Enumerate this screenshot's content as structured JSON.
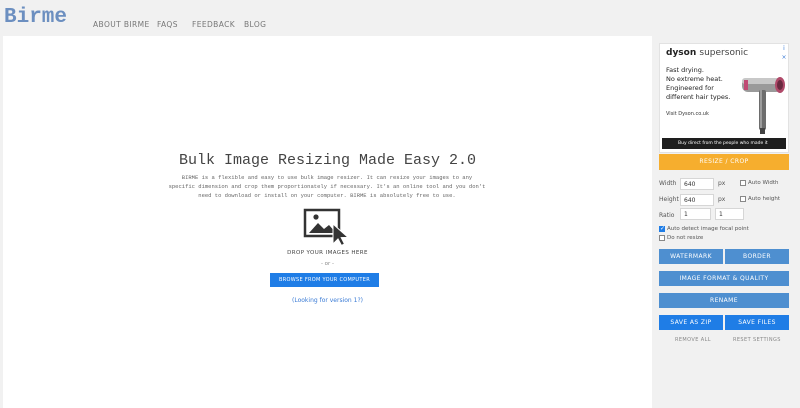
{
  "header": {
    "logo": "Birme",
    "nav": [
      "ABOUT BIRME",
      "FAQS",
      "FEEDBACK",
      "BLOG"
    ]
  },
  "main": {
    "headline": "Bulk Image Resizing Made Easy 2.0",
    "description": "BIRME is a flexible and easy to use bulk image resizer. It can resize your images to any specific dimension and crop them proportionately if necessary. It's an online tool and you don't need to download or install on your computer. BIRME is absolutely free to use.",
    "drop_text": "DROP YOUR IMAGES HERE",
    "or_text": "- or -",
    "browse_label": "BROWSE FROM YOUR COMPUTER",
    "v1_link": "(Looking for version 1?)"
  },
  "ad": {
    "brand": "dyson",
    "brand_sub": "supersonic",
    "copy": "Fast drying.\nNo extreme heat.\nEngineered for different hair types.",
    "visit": "Visit Dyson.co.uk",
    "bar_text": "Buy direct from the people who made it",
    "info_icon": "i",
    "close_icon": "×"
  },
  "sidebar": {
    "resize_label": "RESIZE / CROP",
    "width_label": "Width",
    "width_value": "640",
    "height_label": "Height",
    "height_value": "640",
    "unit": "px",
    "auto_width": "Auto Width",
    "auto_height": "Auto height",
    "ratio_label": "Ratio",
    "ratio_a": "1",
    "ratio_b": "1",
    "focal_point": "Auto detect image focal point",
    "focal_point_checked": true,
    "do_not_resize": "Do not resize",
    "do_not_resize_checked": false,
    "watermark": "WATERMARK",
    "border": "BORDER",
    "format_quality": "IMAGE FORMAT & QUALITY",
    "rename": "RENAME",
    "save_zip": "SAVE AS ZIP",
    "save_files": "SAVE FILES",
    "remove_all": "REMOVE ALL",
    "reset_settings": "RESET SETTINGS"
  },
  "colors": {
    "accent_orange": "#f6ae2e",
    "button_blue": "#4e8fd0",
    "primary_blue": "#1f7de6",
    "logo_blue": "#6c8fc0"
  }
}
